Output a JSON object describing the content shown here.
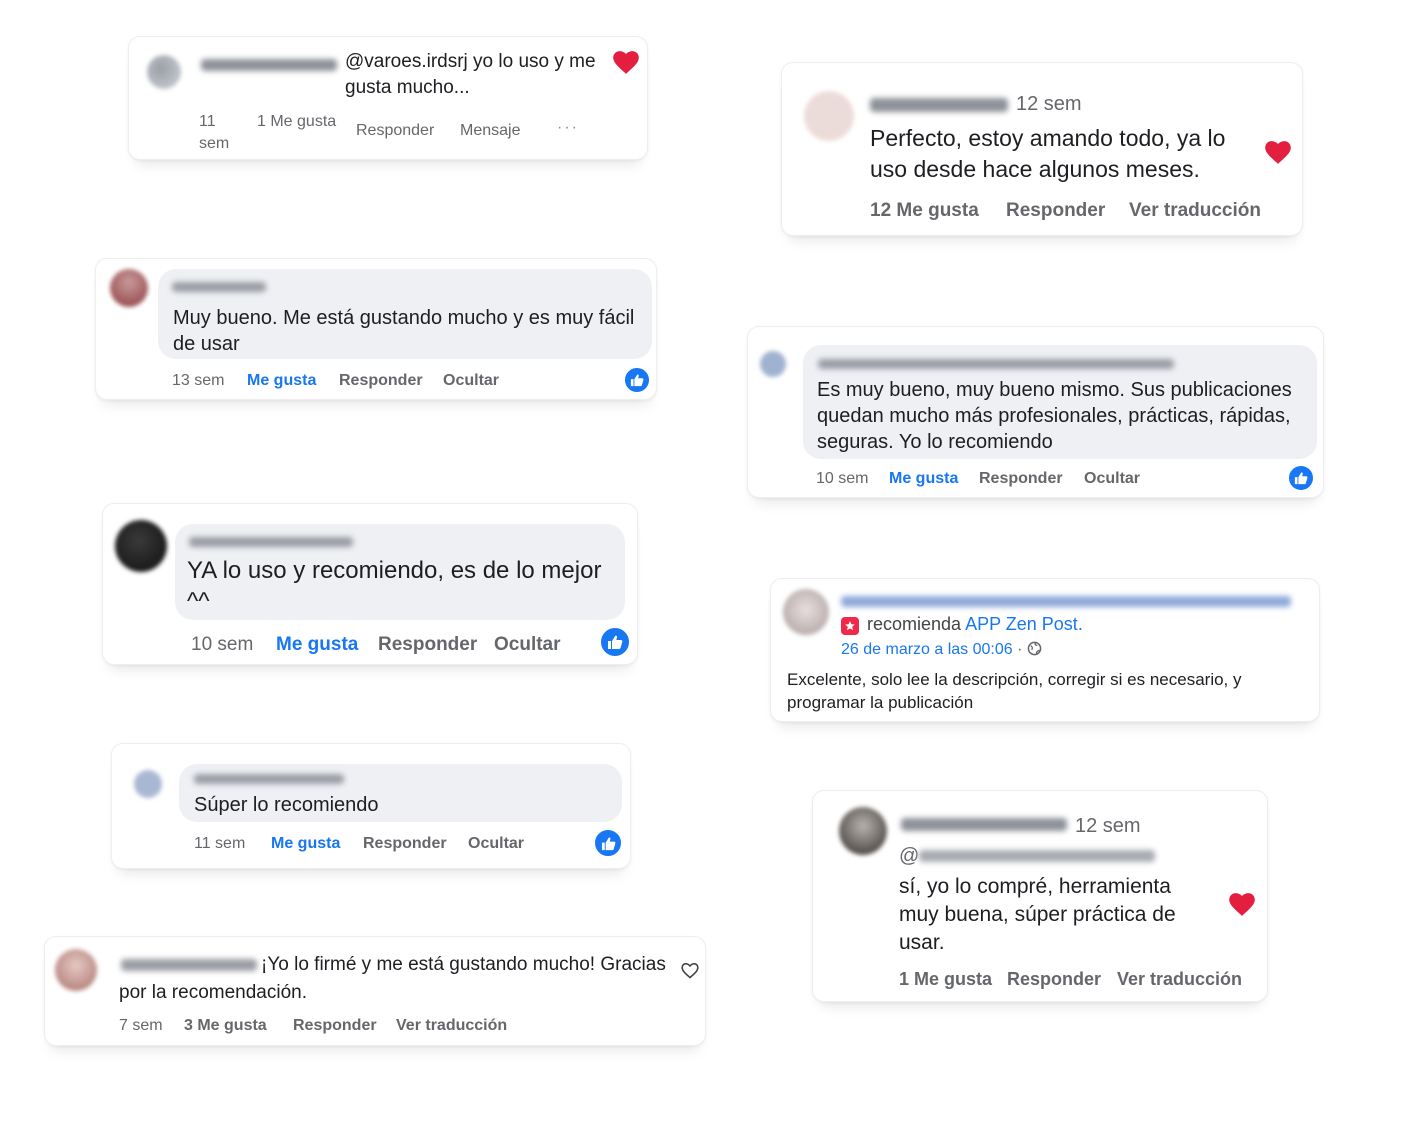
{
  "colors": {
    "brand_blue": "#1877f2",
    "heart_red": "#e41e3f",
    "meta_gray": "#65676b",
    "bubble_bg": "#eef0f4"
  },
  "c1": {
    "text": "@varoes.irdsrj yo lo uso y me gusta mucho...",
    "time": "11 sem",
    "likes": "1 Me gusta",
    "reply": "Responder",
    "message": "Mensaje",
    "more": "···",
    "reaction_icon": "heart-icon"
  },
  "c2": {
    "time": "12 sem",
    "text": "Perfecto, estoy amando todo, ya lo uso desde hace algunos meses.",
    "likes": "12 Me gusta",
    "reply": "Responder",
    "translate": "Ver traducción",
    "reaction_icon": "heart-icon"
  },
  "c3": {
    "text": "Muy bueno. Me está gustando mucho y es muy fácil de usar",
    "time": "13 sem",
    "like": "Me gusta",
    "reply": "Responder",
    "hide": "Ocultar",
    "reaction_icon": "thumbs-up-icon"
  },
  "c4": {
    "text": "Es muy bueno, muy bueno mismo. Sus publicaciones quedan mucho más profesionales, prácticas, rápidas, seguras. Yo lo recomiendo",
    "time": "10 sem",
    "like": "Me gusta",
    "reply": "Responder",
    "hide": "Ocultar",
    "reaction_icon": "thumbs-up-icon"
  },
  "c5": {
    "text": "YA lo uso y recomiendo, es de lo mejor ^^",
    "time": "10 sem",
    "like": "Me gusta",
    "reply": "Responder",
    "hide": "Ocultar",
    "reaction_icon": "thumbs-up-icon"
  },
  "c6": {
    "recommends": "recomienda",
    "page": "APP Zen Post",
    "page_suffix": ".",
    "date": "26 de marzo a las 00:06",
    "separator": "·",
    "text": "Excelente, solo lee la descripción, corregir si es necesario, y programar la publicación",
    "badge_icon": "recommend-star-icon",
    "privacy_icon": "globe-icon"
  },
  "c7": {
    "text": "Súper lo recomiendo",
    "time": "11 sem",
    "like": "Me gusta",
    "reply": "Responder",
    "hide": "Ocultar",
    "reaction_icon": "thumbs-up-icon"
  },
  "c8": {
    "time": "12 sem",
    "mention_prefix": "@",
    "text": "sí, yo lo compré, herramienta muy buena, súper práctica de usar.",
    "likes": "1 Me gusta",
    "reply": "Responder",
    "translate": "Ver traducción",
    "reaction_icon": "heart-icon"
  },
  "c9": {
    "text": "¡Yo lo firmé y me está gustando mucho! Gracias por la recomendación.",
    "time": "7 sem",
    "likes": "3 Me gusta",
    "reply": "Responder",
    "translate": "Ver traducción",
    "reaction_icon": "heart-outline-icon"
  }
}
